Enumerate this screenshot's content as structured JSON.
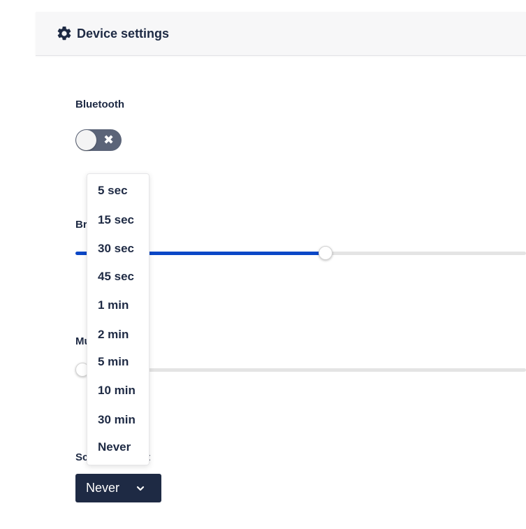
{
  "header": {
    "title": "Device settings",
    "icon": "gear-icon"
  },
  "bluetooth": {
    "label": "Bluetooth",
    "enabled": false,
    "off_glyph": "✖"
  },
  "brightness": {
    "label_visible": "Br",
    "value_fraction": 0.555
  },
  "music": {
    "label_visible": "Mu",
    "value_fraction": 0.0
  },
  "screen_timeout": {
    "label_left_visible": "Sc",
    "label_right_visible": "t",
    "selected": "Never",
    "options": [
      "5 sec",
      "15 sec",
      "30 sec",
      "45 sec",
      "1 min",
      "2 min",
      "5 min",
      "10 min",
      "30 min",
      "Never"
    ]
  },
  "colors": {
    "accent": "#0a47c7",
    "navy": "#1e2a44",
    "toggle_off": "#5b6478"
  }
}
